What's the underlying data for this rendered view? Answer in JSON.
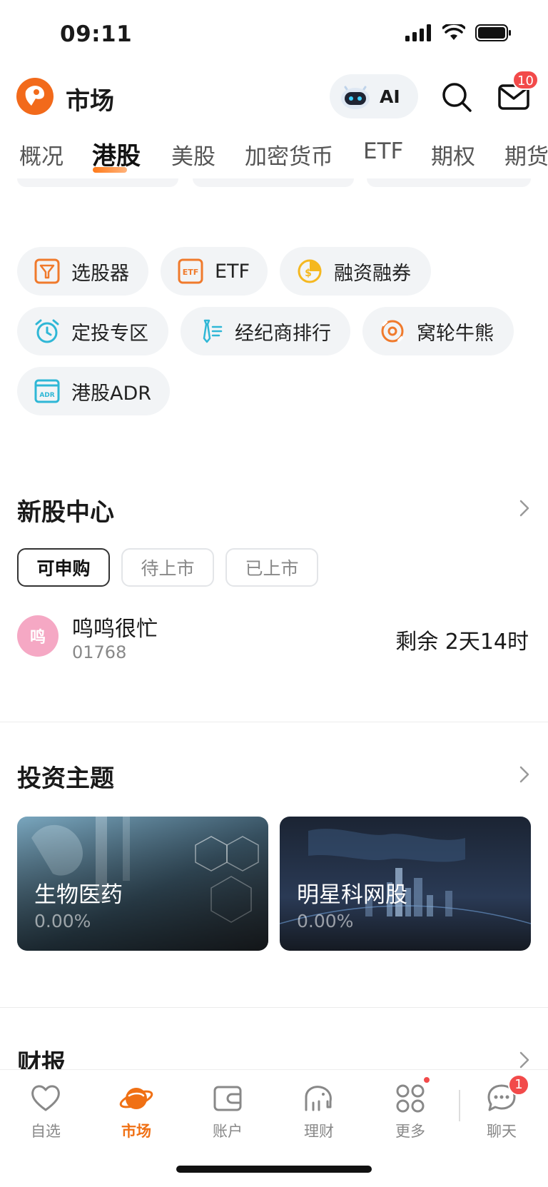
{
  "status": {
    "time": "09:11"
  },
  "header": {
    "title": "市场",
    "ai_label": "AI",
    "mail_badge": "10"
  },
  "tabs": [
    "概况",
    "港股",
    "美股",
    "加密货币",
    "ETF",
    "期权",
    "期货"
  ],
  "tools": [
    {
      "label": "选股器",
      "icon": "stock-filter-icon",
      "color": "#f07a2c"
    },
    {
      "label": "ETF",
      "icon": "etf-icon",
      "color": "#f07a2c"
    },
    {
      "label": "融资融券",
      "icon": "margin-coin-icon",
      "color": "#f5b820"
    },
    {
      "label": "定投专区",
      "icon": "alarm-clock-icon",
      "color": "#2fb7d6"
    },
    {
      "label": "经纪商排行",
      "icon": "broker-tie-icon",
      "color": "#2fb7d6"
    },
    {
      "label": "窝轮牛熊",
      "icon": "warrant-icon",
      "color": "#f07a2c"
    },
    {
      "label": "港股ADR",
      "icon": "adr-icon",
      "color": "#2fb7d6"
    }
  ],
  "ipo": {
    "title": "新股中心",
    "filters": [
      "可申购",
      "待上市",
      "已上市"
    ],
    "active_filter": "可申购",
    "item": {
      "avatar": "鸣",
      "name": "鸣鸣很忙",
      "code": "01768",
      "remaining": "剩余 2天14时"
    }
  },
  "themes": {
    "title": "投资主题",
    "cards": [
      {
        "name": "生物医药",
        "change": "0.00%"
      },
      {
        "name": "明星科网股",
        "change": "0.00%"
      }
    ]
  },
  "earnings": {
    "title": "财报"
  },
  "nav": {
    "items": [
      {
        "label": "自选",
        "icon": "heart-icon"
      },
      {
        "label": "市场",
        "icon": "planet-icon"
      },
      {
        "label": "账户",
        "icon": "wallet-icon"
      },
      {
        "label": "理财",
        "icon": "elephant-icon"
      },
      {
        "label": "更多",
        "icon": "grid-icon"
      },
      {
        "label": "聊天",
        "icon": "chat-icon"
      }
    ],
    "active": "市场",
    "chat_badge": "1"
  },
  "colors": {
    "accent": "#f07014",
    "badge": "#f24a4a",
    "chip_bg": "#f2f4f6"
  }
}
